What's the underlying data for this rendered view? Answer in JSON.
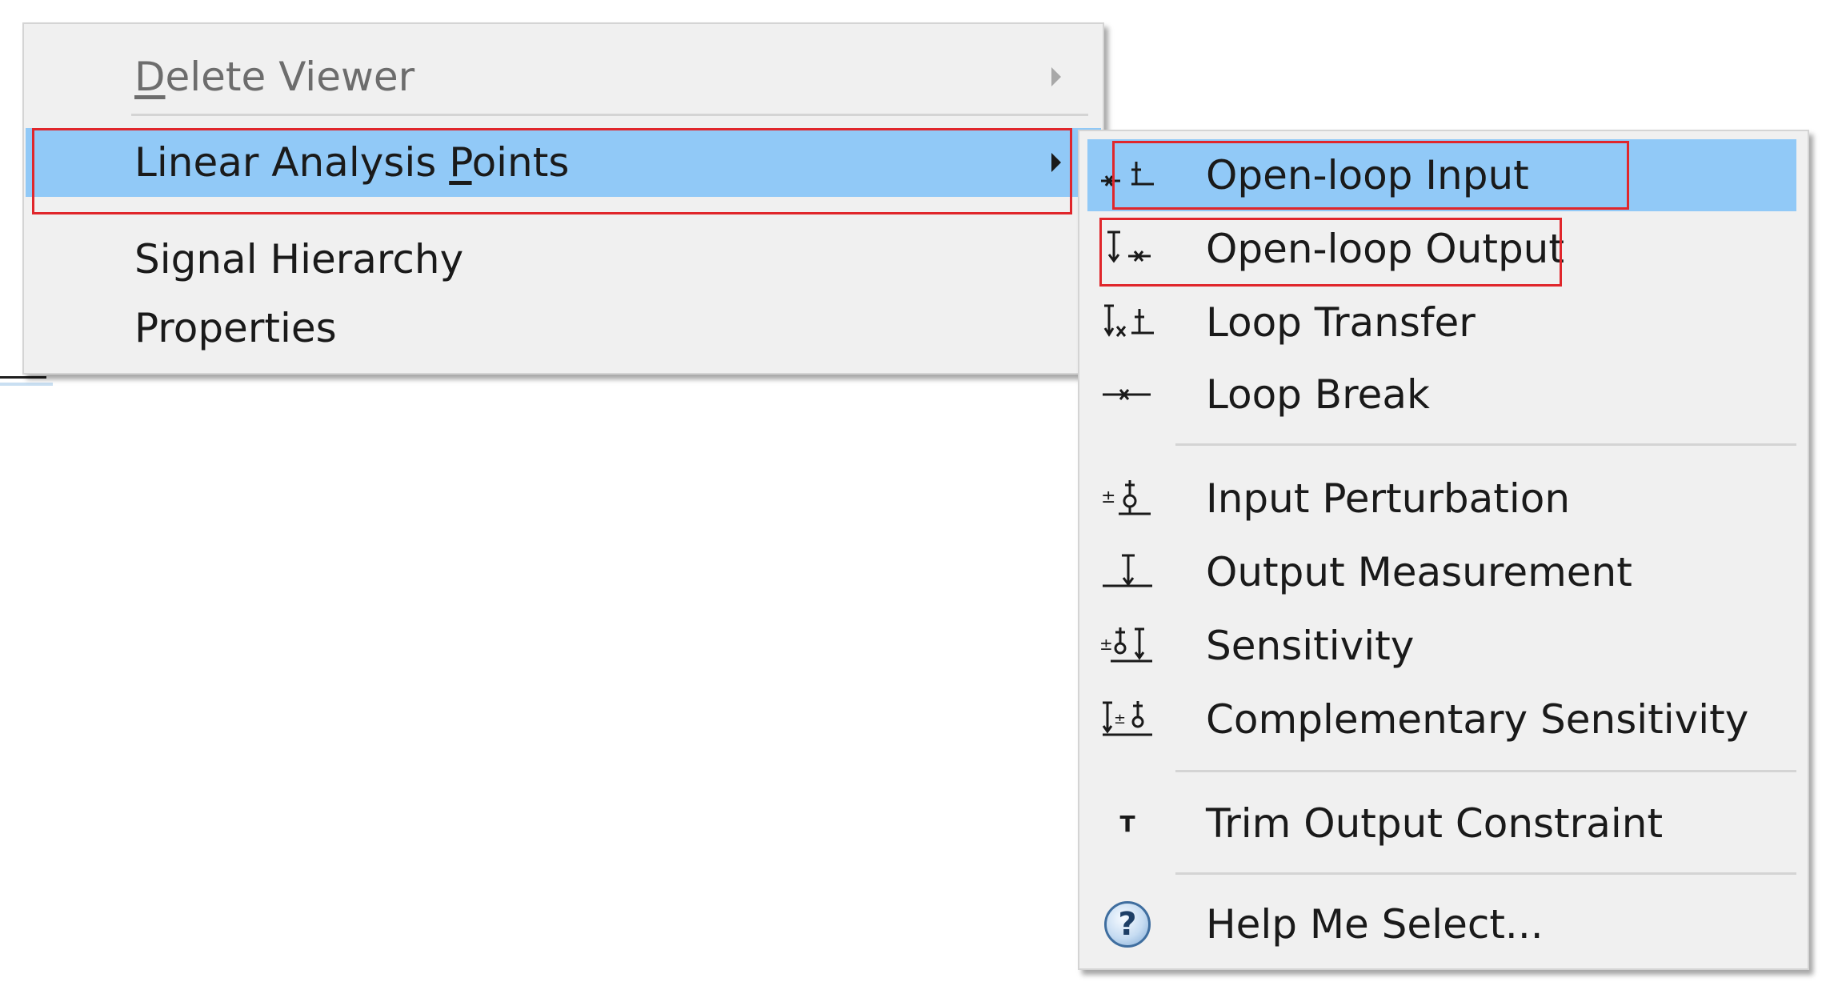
{
  "main_menu": {
    "items": [
      {
        "label_pre": "",
        "label_u": "D",
        "label_post": "elete Viewer",
        "disabled": true,
        "has_submenu": true
      },
      {
        "label_pre": "Linear Analysis ",
        "label_u": "P",
        "label_post": "oints",
        "disabled": false,
        "has_submenu": true,
        "highlighted": true
      },
      {
        "label": "Signal Hierarchy"
      },
      {
        "label": "Properties"
      }
    ]
  },
  "submenu": {
    "items": [
      {
        "label": "Open-loop Input",
        "icon": "open-loop-input-icon",
        "highlighted": true
      },
      {
        "label": "Open-loop Output",
        "icon": "open-loop-output-icon"
      },
      {
        "label": "Loop Transfer",
        "icon": "loop-transfer-icon"
      },
      {
        "label": "Loop Break",
        "icon": "loop-break-icon"
      },
      {
        "label": "Input Perturbation",
        "icon": "input-perturbation-icon"
      },
      {
        "label": "Output Measurement",
        "icon": "output-measurement-icon"
      },
      {
        "label": "Sensitivity",
        "icon": "sensitivity-icon"
      },
      {
        "label": "Complementary Sensitivity",
        "icon": "complementary-sensitivity-icon"
      },
      {
        "label": "Trim Output Constraint",
        "icon": "trim-output-constraint-icon",
        "icon_glyph": "T"
      },
      {
        "label": "Help Me Select...",
        "icon": "help-icon",
        "icon_glyph": "?"
      }
    ]
  },
  "colors": {
    "menu_bg": "#f0f0f0",
    "highlight": "#91c9f7",
    "annotation": "#e0262b",
    "disabled_text": "#6d6d6d"
  }
}
